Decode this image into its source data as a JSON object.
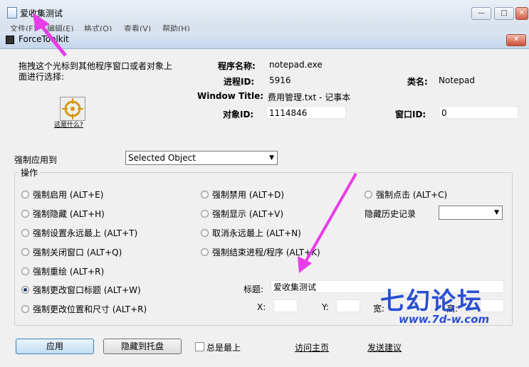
{
  "bg_window": {
    "title": "爱收集测试",
    "menu": [
      "文件(F)",
      "编辑(E)",
      "格式(O)",
      "查看(V)",
      "帮助(H)"
    ],
    "buttons": {
      "minimize": "—",
      "maximize": "□",
      "close": "✕"
    }
  },
  "dialog": {
    "title": "ForceToolkit",
    "close": "✕",
    "instruction": [
      "拖拽这个光标到其他程序窗口或者对象上",
      "面进行选择:"
    ],
    "what_is_this": "这是什么?",
    "program_name_label": "程序名称:",
    "program_name": "notepad.exe",
    "process_id_label": "进程ID:",
    "process_id": "5916",
    "class_label": "类名:",
    "class_name": "Notepad",
    "window_title_label": "Window Title:",
    "window_title": "费用管理.txt - 记事本",
    "object_id_label": "对象ID:",
    "object_id": "1114846",
    "window_id_label": "窗口ID:",
    "window_id": "0",
    "apply_to_label": "强制应用到",
    "apply_to_value": "Selected Object",
    "operations_label": "操作",
    "ops": {
      "enable": "强制启用 (ALT+E)",
      "disable": "强制禁用 (ALT+D)",
      "click": "强制点击 (ALT+C)",
      "hide": "强制隐藏 (ALT+H)",
      "show": "强制显示 (ALT+V)",
      "topmost": "强制设置永远最上 (ALT+T)",
      "untopmost": "取消永远最上 (ALT+N)",
      "close": "强制关闭窗口 (ALT+Q)",
      "kill": "强制结束进程/程序 (ALT+K)",
      "redraw": "强制重绘 (ALT+R)",
      "retitle": "强制更改窗口标题 (ALT+W)",
      "move": "强制更改位置和尺寸 (ALT+R)"
    },
    "hide_history_label": "隐藏历史记录",
    "title_label": "标题:",
    "title_value": "爱收集测试",
    "x_label": "X:",
    "y_label": "Y:",
    "w_label": "宽:",
    "h_label": "高:",
    "apply_button": "应用",
    "tray_button": "隐藏到托盘",
    "always_top": "总是最上",
    "homepage_link": "访问主页",
    "feedback_link": "发送建议"
  },
  "watermark": {
    "cn": "七幻论坛",
    "url": "www.7d-w.com"
  },
  "colors": {
    "arrow": "#e83ce8",
    "watermark": "#2a4fd1"
  }
}
